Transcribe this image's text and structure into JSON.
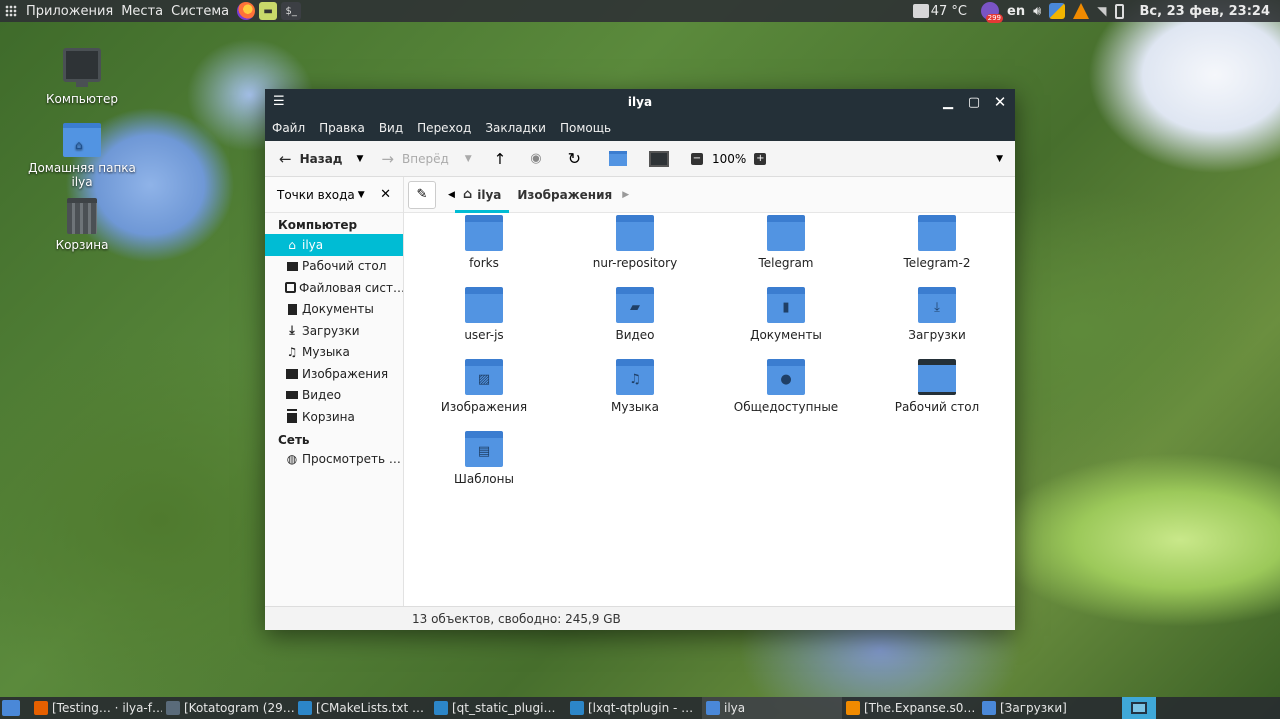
{
  "top_panel": {
    "menus": [
      "Приложения",
      "Места",
      "Система"
    ],
    "temperature": "47 °C",
    "badge_count": "299",
    "language": "en",
    "clock": "Вс, 23 фев, 23:24"
  },
  "desktop_icons": [
    {
      "label": "Компьютер",
      "icon": "monitor-icon"
    },
    {
      "label": "Домашняя папка ilya",
      "icon": "home-folder-icon"
    },
    {
      "label": "Корзина",
      "icon": "trash-icon"
    }
  ],
  "window": {
    "title": "ilya",
    "menubar": [
      "Файл",
      "Правка",
      "Вид",
      "Переход",
      "Закладки",
      "Помощь"
    ],
    "toolbar": {
      "back_label": "Назад",
      "forward_label": "Вперёд",
      "zoom": "100%"
    },
    "sidebar": {
      "places_label": "Точки входа",
      "sections": [
        {
          "title": "Компьютер",
          "items": [
            {
              "label": "ilya",
              "icon": "home-icon",
              "active": true
            },
            {
              "label": "Рабочий стол",
              "icon": "desktop-icon"
            },
            {
              "label": "Файловая сист…",
              "icon": "drive-icon"
            },
            {
              "label": "Документы",
              "icon": "document-icon"
            },
            {
              "label": "Загрузки",
              "icon": "download-icon"
            },
            {
              "label": "Музыка",
              "icon": "music-icon"
            },
            {
              "label": "Изображения",
              "icon": "image-icon"
            },
            {
              "label": "Видео",
              "icon": "video-icon"
            },
            {
              "label": "Корзина",
              "icon": "trash-icon"
            }
          ]
        },
        {
          "title": "Сеть",
          "items": [
            {
              "label": "Просмотреть …",
              "icon": "globe-icon"
            }
          ]
        }
      ]
    },
    "pathbar": {
      "crumbs": [
        "ilya",
        "Изображения"
      ]
    },
    "files": [
      {
        "name": "forks",
        "icon": "folder-icon"
      },
      {
        "name": "nur-repository",
        "icon": "folder-icon"
      },
      {
        "name": "Telegram",
        "icon": "folder-icon"
      },
      {
        "name": "Telegram-2",
        "icon": "folder-icon"
      },
      {
        "name": "user-js",
        "icon": "folder-icon"
      },
      {
        "name": "Видео",
        "icon": "folder-video-icon"
      },
      {
        "name": "Документы",
        "icon": "folder-documents-icon"
      },
      {
        "name": "Загрузки",
        "icon": "folder-download-icon"
      },
      {
        "name": "Изображения",
        "icon": "folder-pictures-icon"
      },
      {
        "name": "Музыка",
        "icon": "folder-music-icon"
      },
      {
        "name": "Общедоступные",
        "icon": "folder-public-icon"
      },
      {
        "name": "Рабочий стол",
        "icon": "folder-desktop-icon"
      },
      {
        "name": "Шаблоны",
        "icon": "folder-templates-icon"
      }
    ],
    "status": "13 объектов, свободно: 245,9 GB"
  },
  "taskbar": {
    "tasks": [
      {
        "label": "[Testing… · ilya-f…",
        "color": "#e66000"
      },
      {
        "label": "[Kotatogram (29…",
        "color": "#5a6b7a"
      },
      {
        "label": "[CMakeLists.txt …",
        "color": "#2c86c8"
      },
      {
        "label": "[qt_static_plugi…",
        "color": "#2c86c8"
      },
      {
        "label": "[lxqt-qtplugin - …",
        "color": "#2c86c8"
      },
      {
        "label": "ilya",
        "color": "#4a88d8",
        "current": true
      },
      {
        "label": "[The.Expanse.s0…",
        "color": "#f08a00"
      },
      {
        "label": "[Загрузки]",
        "color": "#4a88d8"
      }
    ]
  },
  "colors": {
    "accent": "#00bcd4",
    "folder": "#5294e2",
    "titlebar": "#243038"
  }
}
